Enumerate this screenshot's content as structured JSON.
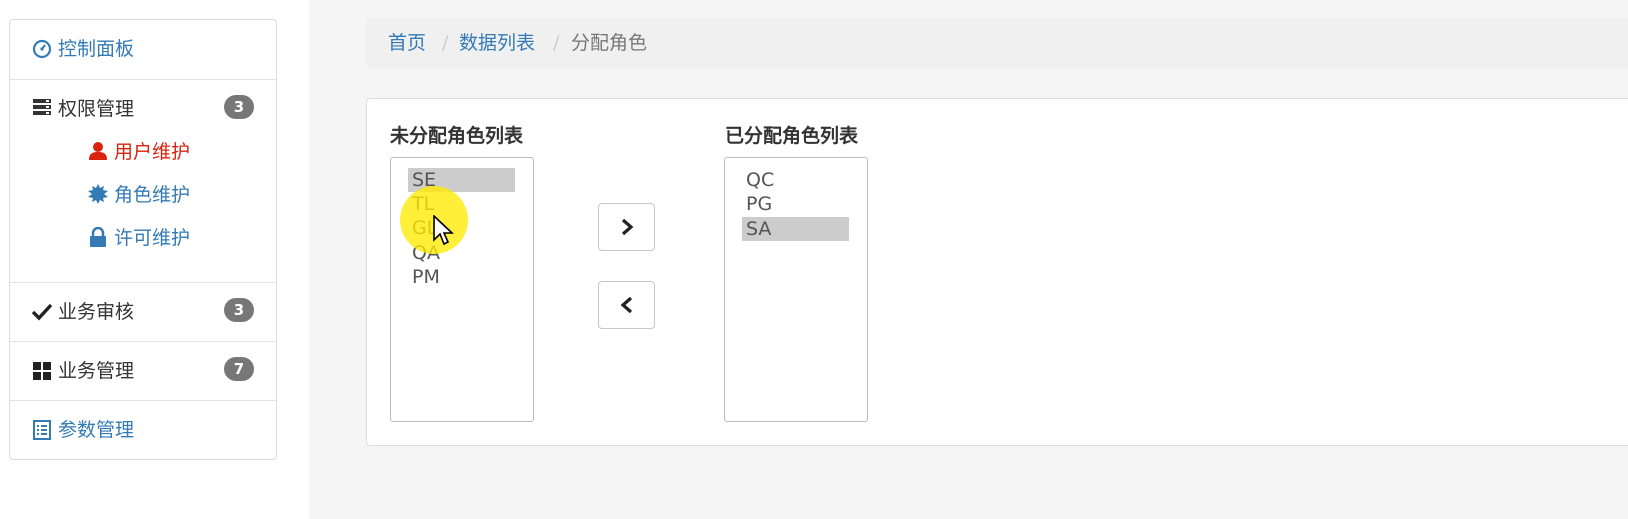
{
  "sidebar": {
    "dashboard": {
      "label": "控制面板",
      "icon": "dashboard-icon"
    },
    "permissions": {
      "label": "权限管理",
      "badge": "3",
      "icon": "server-icon",
      "items": [
        {
          "label": "用户维护",
          "icon": "user-icon",
          "color": "#d9230f",
          "active": true
        },
        {
          "label": "角色维护",
          "icon": "certificate-icon",
          "color": "#337ab7"
        },
        {
          "label": "许可维护",
          "icon": "lock-icon",
          "color": "#337ab7"
        }
      ]
    },
    "audit": {
      "label": "业务审核",
      "badge": "3",
      "icon": "check-icon"
    },
    "business": {
      "label": "业务管理",
      "badge": "7",
      "icon": "grid-icon"
    },
    "params": {
      "label": "参数管理",
      "icon": "list-alt-icon"
    }
  },
  "breadcrumb": {
    "items": [
      "首页",
      "数据列表",
      "分配角色"
    ],
    "separator": "/"
  },
  "assign": {
    "unassigned_title": "未分配角色列表",
    "assigned_title": "已分配角色列表",
    "unassigned_options": [
      "SE",
      "TL",
      "GL",
      "QA",
      "PM"
    ],
    "unassigned_selected": "SE",
    "assigned_options": [
      "QC",
      "PG",
      "SA"
    ],
    "assigned_selected": "SA",
    "move_right_icon": "chevron-right-icon",
    "move_left_icon": "chevron-left-icon"
  }
}
